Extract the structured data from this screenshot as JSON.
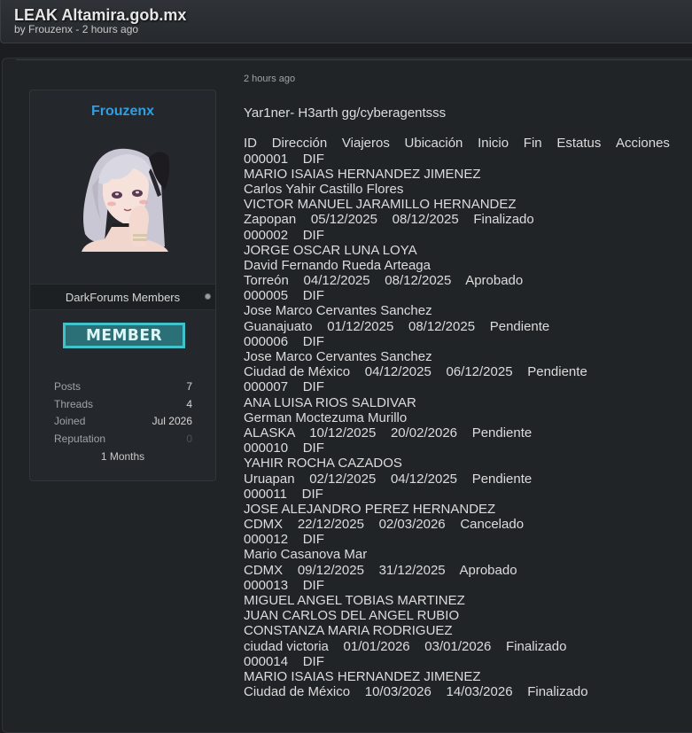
{
  "thread": {
    "title": "LEAK Altamira.gob.mx",
    "meta": "by Frouzenx - 2 hours ago"
  },
  "author": {
    "name": "Frouzenx",
    "group": "DarkForums Members",
    "rank_badge": "MEMBER",
    "stats": [
      {
        "label": "Posts",
        "value": "7"
      },
      {
        "label": "Threads",
        "value": "4"
      },
      {
        "label": "Joined",
        "value": "Jul 2026"
      },
      {
        "label": "Reputation",
        "value": "0"
      }
    ],
    "tenure": "1 Months",
    "avatar_icon": "anime-avatar-icon"
  },
  "post": {
    "date": "2 hours ago",
    "intro": "Yar1ner- H3arth gg/cyberagentsss",
    "table_headers": [
      "ID",
      "Dirección",
      "Viajeros",
      "Ubicación",
      "Inicio",
      "Fin",
      "Estatus",
      "Acciones"
    ],
    "lines": [
      "000001    DIF",
      "MARIO ISAIAS HERNANDEZ JIMENEZ",
      "Carlos Yahir Castillo Flores",
      "VICTOR MANUEL JARAMILLO HERNANDEZ",
      "Zapopan    05/12/2025    08/12/2025    Finalizado",
      "000002    DIF",
      "JORGE OSCAR LUNA LOYA",
      "David Fernando Rueda Arteaga",
      "Torreón    04/12/2025    08/12/2025    Aprobado",
      "000005    DIF",
      "Jose Marco Cervantes Sanchez",
      "Guanajuato    01/12/2025    08/12/2025    Pendiente",
      "000006    DIF",
      "Jose Marco Cervantes Sanchez",
      "Ciudad de México    04/12/2025    06/12/2025    Pendiente",
      "000007    DIF",
      "ANA LUISA RIOS SALDIVAR",
      "German Moctezuma Murillo",
      "ALASKA    10/12/2025    20/02/2026    Pendiente",
      "000010    DIF",
      "YAHIR ROCHA CAZADOS",
      "Uruapan    02/12/2025    04/12/2025    Pendiente",
      "000011    DIF",
      "JOSE ALEJANDRO PEREZ HERNANDEZ",
      "CDMX    22/12/2025    02/03/2026    Cancelado",
      "000012    DIF",
      "Mario Casanova Mar",
      "CDMX    09/12/2025    31/12/2025    Aprobado",
      "000013    DIF",
      "MIGUEL ANGEL TOBIAS MARTINEZ",
      "JUAN CARLOS DEL ANGEL RUBIO",
      "CONSTANZA MARIA RODRIGUEZ",
      "ciudad victoria    01/01/2026    03/01/2026    Finalizado",
      "000014    DIF",
      "MARIO ISAIAS HERNANDEZ JIMENEZ",
      "Ciudad de México    10/03/2026    14/03/2026    Finalizado"
    ]
  }
}
